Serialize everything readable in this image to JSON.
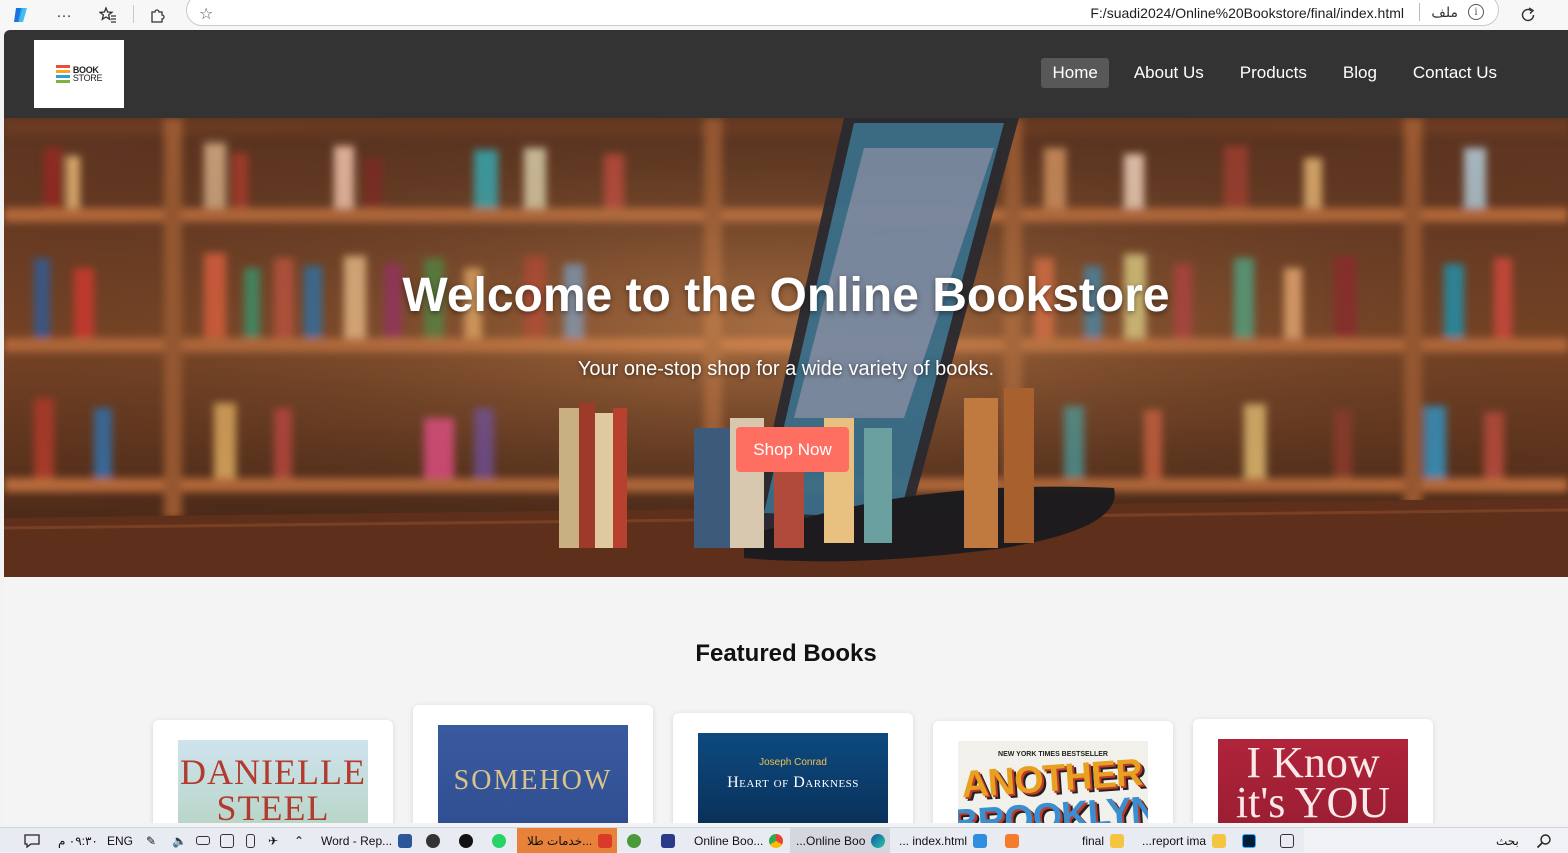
{
  "browser": {
    "url": "F:/suadi2024/Online%20Bookstore/final/index.html",
    "file_label": "ملف",
    "icons": [
      "copilot-icon",
      "more-icon",
      "favorites-icon",
      "extensions-icon",
      "add-favorite-icon",
      "site-info-icon",
      "refresh-icon"
    ]
  },
  "site": {
    "logo": {
      "line1": "BOOK",
      "line2": "STORE"
    },
    "nav": [
      {
        "label": "Home",
        "active": true
      },
      {
        "label": "About Us",
        "active": false
      },
      {
        "label": "Products",
        "active": false
      },
      {
        "label": "Blog",
        "active": false
      },
      {
        "label": "Contact Us",
        "active": false
      }
    ],
    "hero": {
      "title": "Welcome to the Online Bookstore",
      "subtitle": "Your one-stop shop for a wide variety of books.",
      "cta": "Shop Now"
    },
    "featured_title": "Featured Books",
    "books": [
      {
        "line1": "DANIELLE",
        "line2": "STEEL"
      },
      {
        "line1": "SOMEHOW"
      },
      {
        "author": "Joseph Conrad",
        "line1": "Heart of Darkness"
      },
      {
        "top": "NEW YORK TIMES BESTSELLER",
        "line1": "ANOTHER",
        "line2": "BROOKLYN"
      },
      {
        "line1": "I Know",
        "line2": "it's YOU"
      }
    ]
  },
  "taskbar": {
    "search": "بحث",
    "items": [
      "...report ima",
      "final",
      "... index.html",
      "...Online Boo",
      "Online Boo...",
      "خدمات طلا...",
      "Word - Rep..."
    ],
    "lang": "ENG",
    "time": "٠٩:٣٠ م"
  },
  "colors": {
    "nav_bg": "#333333",
    "accent": "#ff6f61",
    "active_nav": "#585858"
  }
}
